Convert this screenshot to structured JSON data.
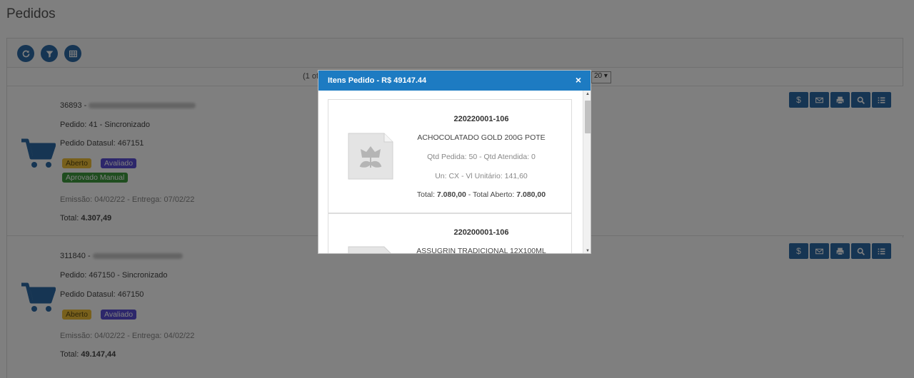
{
  "page": {
    "title": "Pedidos"
  },
  "pager": {
    "info": "(1 of",
    "page_size": "20"
  },
  "orders": [
    {
      "number": "36893 - ",
      "pedido": "Pedido: 41 - Sincronizado",
      "datasul": "Pedido Datasul: 467151",
      "badges": [
        "Aberto",
        "Avaliado",
        "Aprovado Manual"
      ],
      "dates": "Emissão: 04/02/22 - Entrega: 07/02/22",
      "total_label": "Total:",
      "total_value": "4.307,49"
    },
    {
      "number": "311840 - ",
      "pedido": "Pedido: 467150 - Sincronizado",
      "datasul": "Pedido Datasul: 467150",
      "badges": [
        "Aberto",
        "Avaliado"
      ],
      "dates": "Emissão: 04/02/22 - Entrega: 04/02/22",
      "total_label": "Total:",
      "total_value": "49.147,44"
    }
  ],
  "actions": {
    "dollar": "$"
  },
  "modal": {
    "title": "Itens Pedido - R$ 49147.44",
    "close": "×",
    "items": [
      {
        "code": "220220001-106",
        "name": "ACHOCOLATADO GOLD 200G POTE",
        "qtd": "Qtd Pedida: 50 - Qtd Atendida: 0",
        "unit": "Un: CX - Vl Unitário:  141,60",
        "total_label": "Total:",
        "total_value": "7.080,00",
        "aberto_label": " - Total Aberto:",
        "aberto_value": "7.080,00"
      },
      {
        "code": "220200001-106",
        "name": "ASSUGRIN TRADICIONAL 12X100ML"
      }
    ]
  },
  "colors": {
    "primary": "#2c6aa6",
    "modal_header": "#1d7bc2",
    "badge_yellow": "#f0c038",
    "badge_purple": "#5b4fd6",
    "badge_green": "#3f9b3f"
  },
  "icons": [
    "refresh-icon",
    "filter-icon",
    "table-icon",
    "cart-icon",
    "dollar-icon",
    "mail-icon",
    "print-icon",
    "search-icon",
    "list-icon",
    "image-placeholder-icon",
    "close-icon"
  ]
}
